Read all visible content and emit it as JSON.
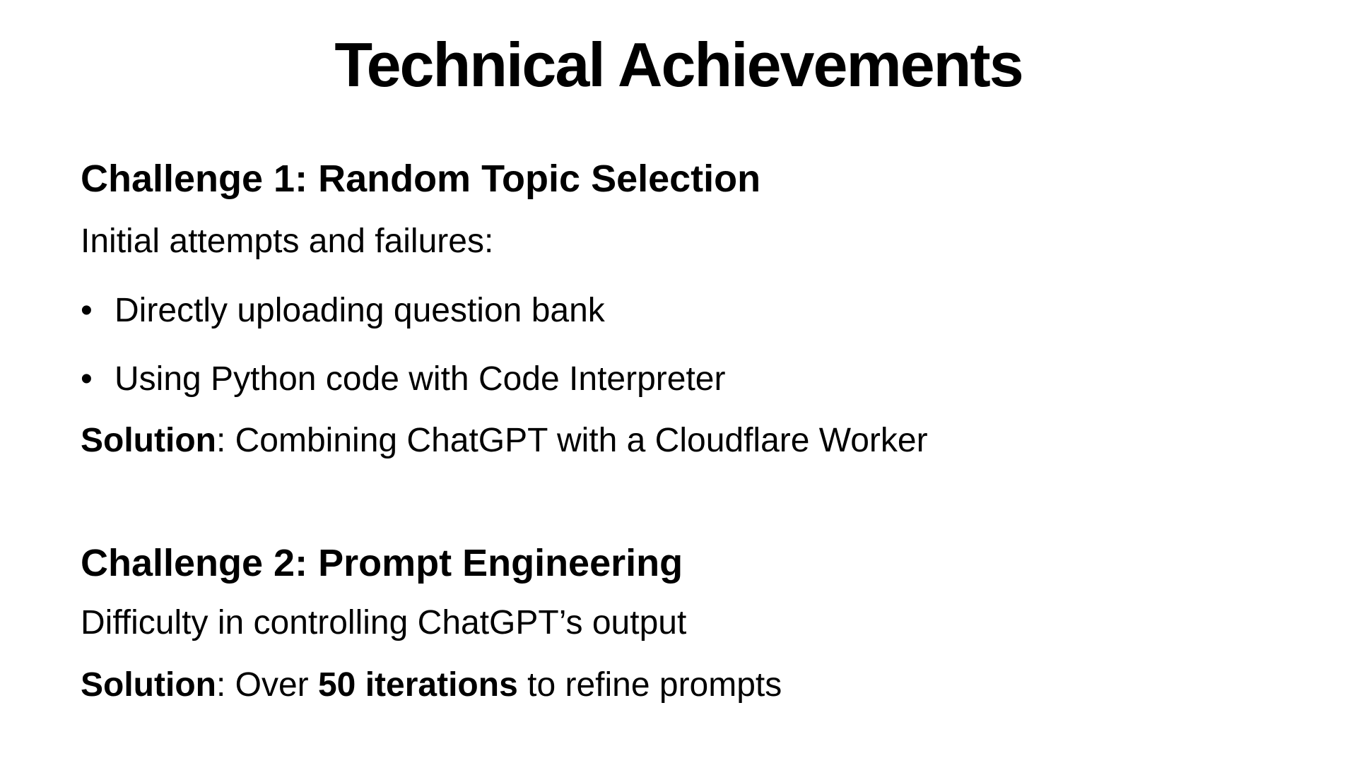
{
  "slide": {
    "title": "Technical Achievements",
    "challenge1": {
      "heading": "Challenge 1: Random Topic Selection",
      "intro": "Initial attempts and failures:",
      "bullets": [
        "Directly uploading question bank",
        "Using Python code with Code Interpreter"
      ],
      "bullet_glyph": "•",
      "solution_label": "Solution",
      "solution_text": ": Combining ChatGPT with a Cloudflare Worker"
    },
    "challenge2": {
      "heading": "Challenge 2: Prompt Engineering",
      "intro": "Difficulty in controlling ChatGPT’s output",
      "solution_label": "Solution",
      "solution_pre": ": Over ",
      "solution_bold": "50 iterations",
      "solution_post": " to refine prompts"
    }
  }
}
